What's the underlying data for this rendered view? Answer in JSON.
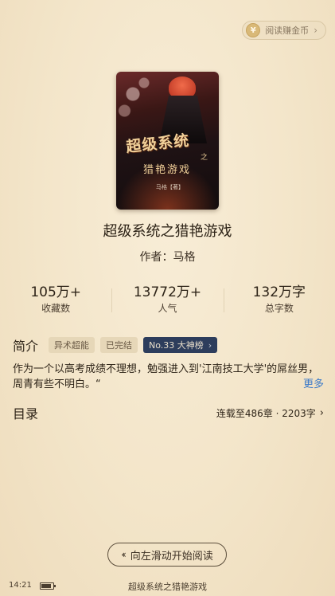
{
  "reward": {
    "label": "阅读赚金币",
    "coin_symbol": "¥",
    "chevron": "›"
  },
  "cover": {
    "title_line1": "超级系统",
    "title_connector": "之",
    "title_line2": "猎艳游戏",
    "author_mark": "马格【著】"
  },
  "book": {
    "title": "超级系统之猎艳游戏",
    "author_line": "作者：马格"
  },
  "stats": [
    {
      "value": "105万+",
      "label": "收藏数"
    },
    {
      "value": "13772万+",
      "label": "人气"
    },
    {
      "value": "132万字",
      "label": "总字数"
    }
  ],
  "intro": {
    "label": "简介",
    "tags": [
      "异术超能",
      "已完结"
    ],
    "rank_tag": "No.33 大神榜",
    "rank_chevron": "›",
    "text": "作为一个以高考成绩不理想，勉强进入到'江南技工大学'的屌丝男，周青有些不明白。“",
    "more": "更多"
  },
  "toc": {
    "label": "目录",
    "status": "连载至486章 · 2203字",
    "chevron": "›"
  },
  "swipe_hint": {
    "arrows": "‹‹",
    "label": "向左滑动开始阅读"
  },
  "status_bar": {
    "time": "14:21",
    "battery_level": 0.85,
    "book_title": "超级系统之猎艳游戏"
  }
}
